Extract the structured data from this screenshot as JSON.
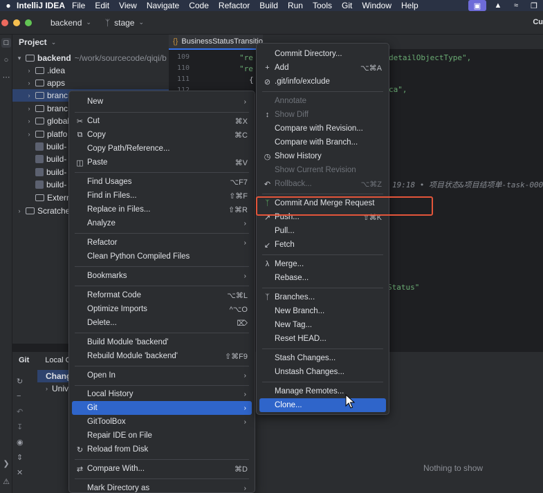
{
  "macbar": {
    "apple": "",
    "app": "IntelliJ IDEA",
    "menus": [
      "File",
      "Edit",
      "View",
      "Navigate",
      "Code",
      "Refactor",
      "Build",
      "Run",
      "Tools",
      "Git",
      "Window",
      "Help"
    ]
  },
  "toolbar": {
    "project": "backend",
    "branch": "stage",
    "right_cut": "Cu"
  },
  "project_panel": {
    "title": "Project",
    "root_name": "backend",
    "root_path": "~/work/sourcecode/qiqi/b",
    "items": [
      {
        "label": ".idea"
      },
      {
        "label": "apps"
      },
      {
        "label": "branc"
      },
      {
        "label": "branc"
      },
      {
        "label": "global"
      },
      {
        "label": "platfo"
      },
      {
        "label": "build-"
      },
      {
        "label": "build-"
      },
      {
        "label": "build-"
      },
      {
        "label": "build-"
      }
    ],
    "external": "External",
    "scratches": "Scratche"
  },
  "editor": {
    "tab_label": "BusinessStatusTransitionLog.json",
    "line_numbers": [
      "109",
      "110",
      "111",
      "112"
    ],
    "line1": "\"re",
    "line2": "\"re",
    "line3": "{",
    "right1": "detailObjectType\",",
    "right2": "ca\",",
    "blame_time": "19:18",
    "blame_text": "• 项目状态&项目结项单-task-000",
    "right3": "Status\""
  },
  "git_panel": {
    "tab1": "Git",
    "tab2": "Local C",
    "row1": "Chang",
    "row2": "Univers",
    "empty": "Nothing to show"
  },
  "context_menu": {
    "items": {
      "new": "New",
      "cut": "Cut",
      "cut_sc": "⌘X",
      "copy": "Copy",
      "copy_sc": "⌘C",
      "copy_path": "Copy Path/Reference...",
      "paste": "Paste",
      "paste_sc": "⌘V",
      "find_usages": "Find Usages",
      "find_usages_sc": "⌥F7",
      "find_in_files": "Find in Files...",
      "find_in_files_sc": "⇧⌘F",
      "replace_in_files": "Replace in Files...",
      "replace_in_files_sc": "⇧⌘R",
      "analyze": "Analyze",
      "refactor": "Refactor",
      "clean_python": "Clean Python Compiled Files",
      "bookmarks": "Bookmarks",
      "reformat": "Reformat Code",
      "reformat_sc": "⌥⌘L",
      "optimize": "Optimize Imports",
      "optimize_sc": "^⌥O",
      "delete": "Delete...",
      "delete_sc": "⌦",
      "build_module": "Build Module 'backend'",
      "rebuild_module": "Rebuild Module 'backend'",
      "rebuild_sc": "⇧⌘F9",
      "open_in": "Open In",
      "local_history": "Local History",
      "git": "Git",
      "gittoolbox": "GitToolBox",
      "repair_ide": "Repair IDE on File",
      "reload": "Reload from Disk",
      "compare_with": "Compare With...",
      "compare_with_sc": "⌘D",
      "mark_directory": "Mark Directory as"
    }
  },
  "git_menu": {
    "items": {
      "commit_dir": "Commit Directory...",
      "add": "Add",
      "add_sc": "⌥⌘A",
      "exclude": ".git/info/exclude",
      "annotate": "Annotate",
      "show_diff": "Show Diff",
      "compare_rev": "Compare with Revision...",
      "compare_branch": "Compare with Branch...",
      "show_history": "Show History",
      "show_current_rev": "Show Current Revision",
      "rollback": "Rollback...",
      "rollback_sc": "⌥⌘Z",
      "commit_merge": "Commit And Merge Request",
      "push": "Push...",
      "push_sc": "⇧⌘K",
      "pull": "Pull...",
      "fetch": "Fetch",
      "merge": "Merge...",
      "rebase": "Rebase...",
      "branches": "Branches...",
      "new_branch": "New Branch...",
      "new_tag": "New Tag...",
      "reset_head": "Reset HEAD...",
      "stash": "Stash Changes...",
      "unstash": "Unstash Changes...",
      "manage_remotes": "Manage Remotes...",
      "clone": "Clone..."
    }
  },
  "colors": {
    "highlight": "#2f65ca",
    "annotation_box": "#e4553a",
    "merge_icon": "#5fb865"
  }
}
